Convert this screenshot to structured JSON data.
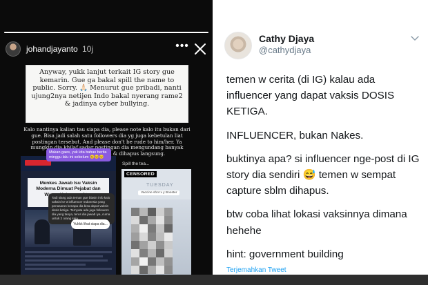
{
  "story": {
    "username": "johandjayanto",
    "time": "10j",
    "progress": 1.0,
    "more_label": "•••",
    "note_main": "Anyway, yukk lanjut terkait IG story gue kemarin. Gue ga bakal spill the name to public. Sorry. 🙏🏻 Menurut gue pribadi, nanti ujung2nya netijen Indo bakal nyerang rame2 & jadinya cyber bullying.",
    "note_secondary": "Kalo nantinya kalian tau siapa dia, please note kalo itu bukan dari gue. Bisa jadi salah satu followers dia yg juga kebetulan liat postingan tersebut. And please don't be rude to him/her. Ya mungkin dia khilaf sadar postingan dia mengundang banyak pertanyaan followers dia & dihapus langsung.",
    "purple_bubble": "Makan gaes, yuk kita bahas berita minggu lalu ini sebelum 😊😊😊",
    "news_title": "Menkes Jawab Isu Vaksin Moderna Dimuat Pejabat dan Warga Kalangan Atas",
    "chat_text": "Tadi siang ada teman gue blasin info kalo vaksin ke-3 influencer Indonesia yang penasaran kenapa dia bisa dapat vaksin dosis ketiga. Ternyata ada juga followers dia yang tanya, terus dia jawab iya, cuma untuk 2 orang saja",
    "reply_text": "Yukkk lihat siapa dia...",
    "spill_label": "Spill the tea...",
    "censored_tag": "CENSORED",
    "censored_day": "TUESDAY",
    "censored_sub": "Vaccine shot x y Booster",
    "pixel_colors": [
      "#7d7d7d",
      "#b8b8b8",
      "#5f5f5f",
      "#cfcfcf",
      "#9a9a9a",
      "#dadada",
      "#6e6e6e",
      "#a8a8a8",
      "#e3e3e3",
      "#8c8c8c",
      "#b0b0b0",
      "#f0f0f0",
      "#7a7a7a",
      "#c4c4c4",
      "#666666",
      "#9e9e9e",
      "#d8d8d8",
      "#858585",
      "#bdbdbd",
      "#e9e9e9",
      "#727272",
      "#a2a2a2",
      "#cecece",
      "#8f8f8f",
      "#c9c9c9",
      "#e1e1e1",
      "#808080",
      "#b5b5b5",
      "#6b6b6b",
      "#d2d2d2",
      "#a5a5a5",
      "#f2f2f2",
      "#777777",
      "#bfbfbf",
      "#929292",
      "#dcdcdc",
      "#6a6a6a",
      "#acacac",
      "#e6e6e6",
      "#8a8a8a"
    ]
  },
  "tweet": {
    "name": "Cathy Djaya",
    "handle": "@cathydjaya",
    "paragraphs": [
      "temen w cerita (di IG) kalau ada influencer yang dapat vaksis DOSIS KETIGA.",
      "INFLUENCER, bukan Nakes.",
      "buktinya apa? si influencer nge-post di IG story dia sendiri 😅 temen w sempat capture sblm dihapus.",
      "btw coba lihat lokasi vaksinnya dimana hehehe",
      "hint: government building"
    ],
    "translate_label": "Terjemahkan Tweet"
  },
  "colors": {
    "twitter_blue": "#1da1f2",
    "story_bg": "#0b0b0b",
    "purple": "#8a5be0"
  },
  "icons": {
    "close": "close-icon",
    "more": "more-icon",
    "chevron": "chevron-down-icon"
  }
}
